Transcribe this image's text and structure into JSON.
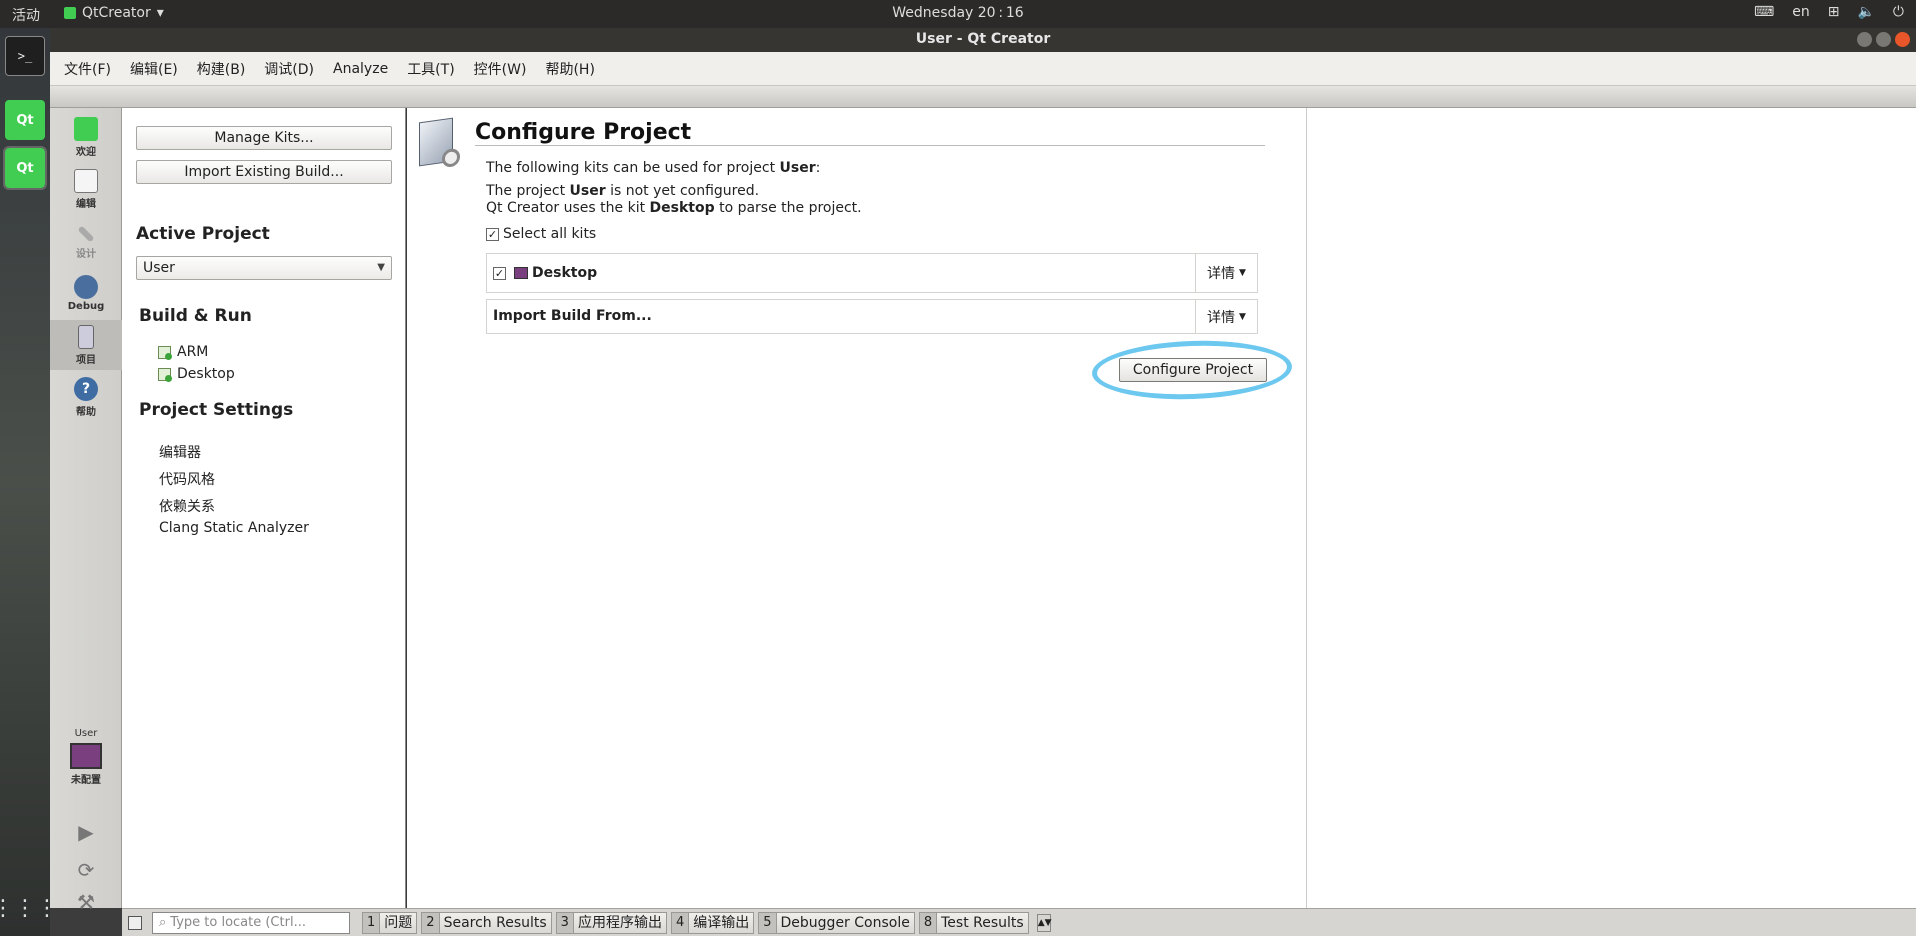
{
  "topbar": {
    "activities": "活动",
    "app_name": "QtCreator",
    "clock": "Wednesday 20 : 16",
    "lang": "en"
  },
  "window": {
    "title": "User - Qt Creator"
  },
  "menu": [
    "文件(F)",
    "编辑(E)",
    "构建(B)",
    "调试(D)",
    "Analyze",
    "工具(T)",
    "控件(W)",
    "帮助(H)"
  ],
  "modes": [
    {
      "label": "欢迎",
      "icon": "qt-welcome-icon"
    },
    {
      "label": "编辑",
      "icon": "edit-document-icon"
    },
    {
      "label": "设计",
      "icon": "design-pen-icon"
    },
    {
      "label": "Debug",
      "icon": "debug-bug-icon"
    },
    {
      "label": "项目",
      "icon": "project-icon"
    },
    {
      "label": "帮助",
      "icon": "help-icon"
    }
  ],
  "target": {
    "project": "User",
    "status": "未配置"
  },
  "left": {
    "manage_kits": "Manage Kits...",
    "import_build": "Import Existing Build...",
    "active_project_heading": "Active Project",
    "active_project_value": "User",
    "build_run_heading": "Build & Run",
    "kits": [
      "ARM",
      "Desktop"
    ],
    "project_settings_heading": "Project Settings",
    "settings": [
      "编辑器",
      "代码风格",
      "依赖关系",
      "Clang Static Analyzer"
    ]
  },
  "main": {
    "title": "Configure Project",
    "intro_prefix": "The following kits can be used for project ",
    "intro_project": "User",
    "intro_suffix": ":",
    "line1_prefix": "The project ",
    "line1_project": "User",
    "line1_suffix": " is not yet configured.",
    "line2_prefix": "Qt Creator uses the kit ",
    "line2_kit": "Desktop",
    "line2_suffix": " to parse the project.",
    "select_all": "Select all kits",
    "kit_desktop": "Desktop",
    "details": "详情",
    "import_from": "Import Build From...",
    "configure_button": "Configure Project"
  },
  "statusbar": {
    "locate_placeholder": "Type to locate (Ctrl...",
    "tabs": [
      {
        "num": "1",
        "label": "问题"
      },
      {
        "num": "2",
        "label": "Search Results"
      },
      {
        "num": "3",
        "label": "应用程序输出"
      },
      {
        "num": "4",
        "label": "编译输出"
      },
      {
        "num": "5",
        "label": "Debugger Console"
      },
      {
        "num": "8",
        "label": "Test Results"
      }
    ]
  },
  "colors": {
    "highlight_circle": "#6cc8ef",
    "qt_green": "#41cd52"
  }
}
